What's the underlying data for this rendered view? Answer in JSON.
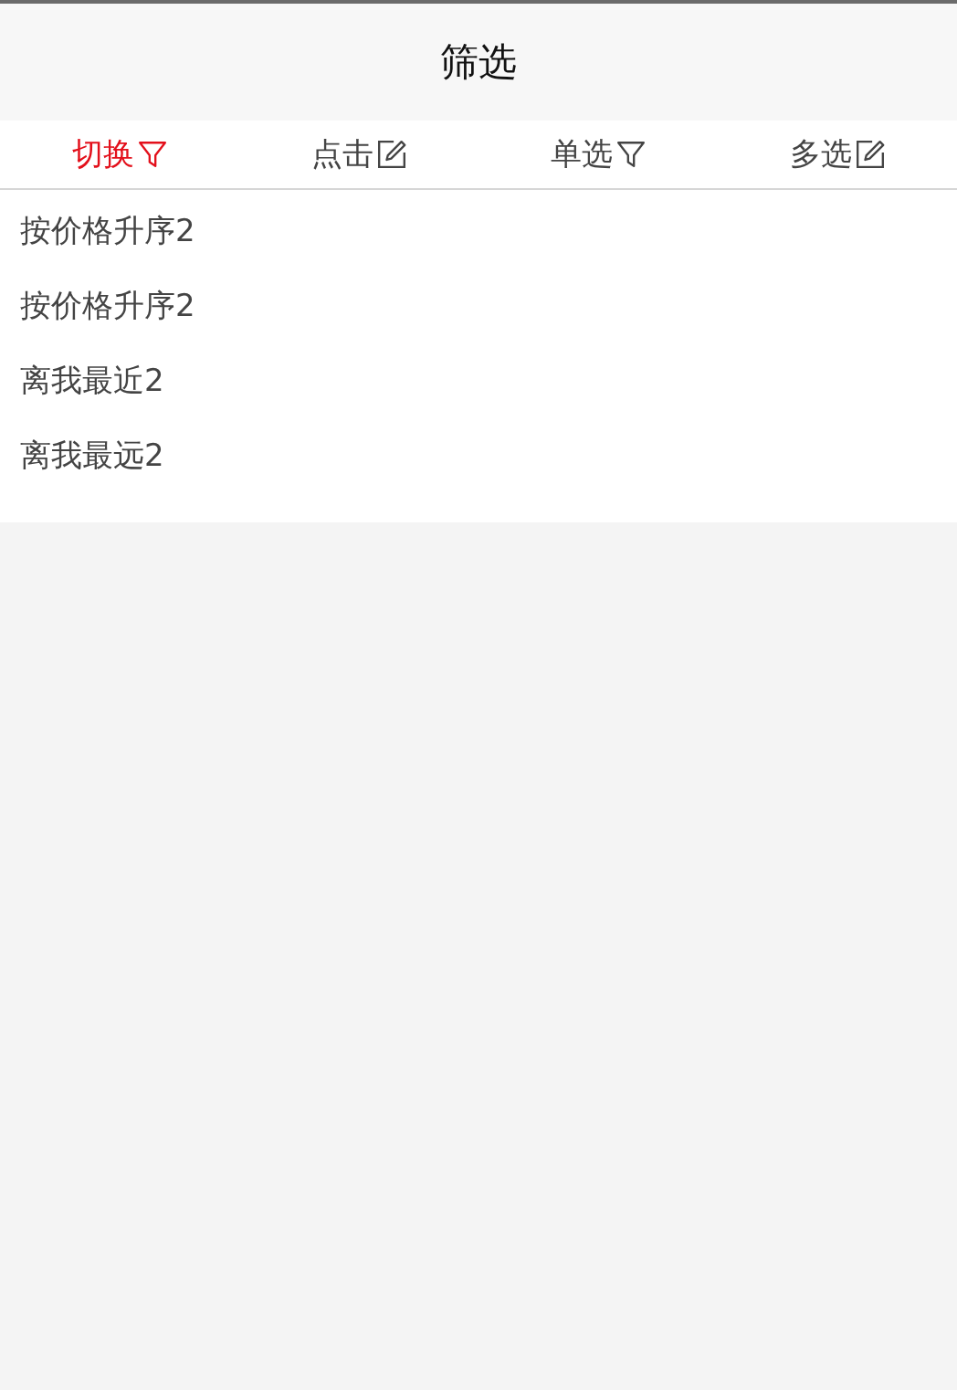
{
  "header": {
    "title": "筛选"
  },
  "tabs": [
    {
      "label": "切换",
      "kind": "filter",
      "selected": true
    },
    {
      "label": "点击",
      "kind": "edit",
      "selected": false
    },
    {
      "label": "单选",
      "kind": "filter",
      "selected": false
    },
    {
      "label": "多选",
      "kind": "edit",
      "selected": false
    }
  ],
  "options": [
    "按价格升序2",
    "按价格升序2",
    "离我最近2",
    "离我最远2"
  ]
}
